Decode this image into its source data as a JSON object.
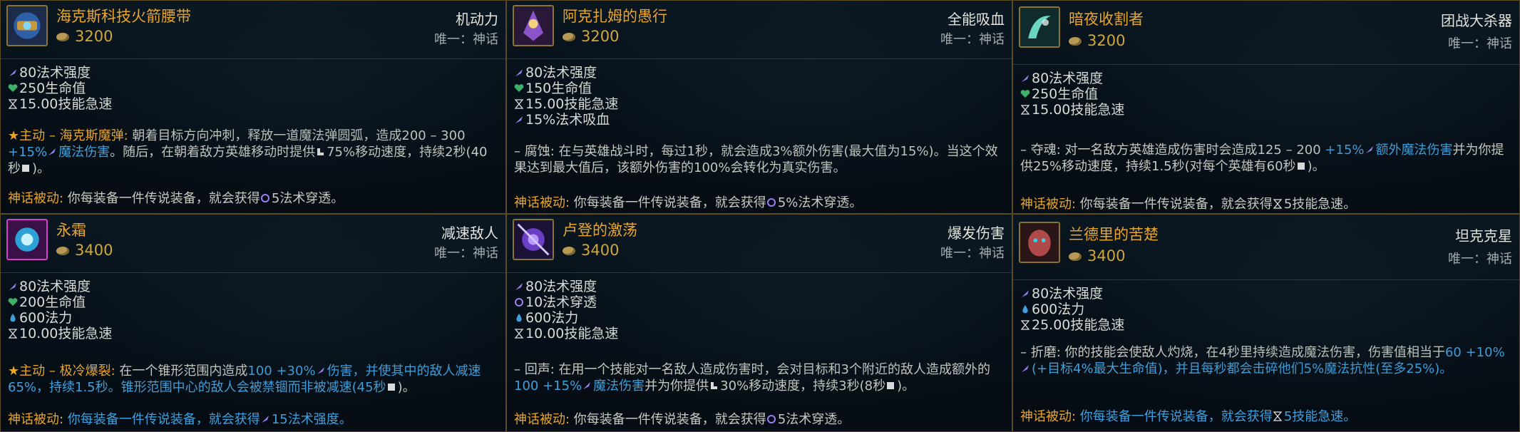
{
  "cards": [
    {
      "name": "海克斯科技火箭腰带",
      "cost": "3200",
      "tag": "机动力",
      "unique": "唯一：神话",
      "stats": [
        "80法术强度",
        "250生命值",
        "15.00技能急速"
      ],
      "desc_label": "★主动 – 海克斯魔弹:",
      "desc_pre": " 朝着目标方向冲刺，释放一道魔法弹圆弧，造成200  –  300",
      "desc_scale": "  +15%",
      "desc_dmg": "魔法伤害",
      "desc_post": "。随后，在朝着敌方英雄移动时提供",
      "desc_post2": "75%移动速度，持续2秒(40秒",
      "desc_end": ")。",
      "mythic_label": "神话被动:",
      "mythic_text": " 你每装备一件传说装备，就会获得",
      "mythic_value": "5法术穿透。"
    },
    {
      "name": "阿克扎姆的愚行",
      "cost": "3200",
      "tag": "全能吸血",
      "unique": "唯一：神话",
      "stats": [
        "80法术强度",
        "150生命值",
        "15.00技能急速",
        "15%法术吸血"
      ],
      "desc_label": "– 腐蚀:",
      "desc_text": " 在与英雄战斗时，每过1秒，就会造成3%额外伤害(最大值为15%)。当这个效果达到最大值后，该额外伤害的100%会转化为真实伤害。",
      "mythic_label": "神话被动:",
      "mythic_text": " 你每装备一件传说装备，就会获得",
      "mythic_value": "5%法术穿透。"
    },
    {
      "name": "暗夜收割者",
      "cost": "3200",
      "tag": "团战大杀器",
      "unique": "唯一：神话",
      "stats": [
        "80法术强度",
        "250生命值",
        "15.00技能急速"
      ],
      "desc_label": "– 夺魂:",
      "desc_pre": " 对一名敌方英雄造成伤害时会造成125  –  200",
      "desc_scale": "  +15%",
      "desc_dmg": "额外魔法伤害",
      "desc_post": "并为你提供25%移动速度，持续1.5秒(对每个英雄有60秒",
      "desc_end": ")。",
      "mythic_label": "神话被动:",
      "mythic_text": " 你每装备一件传说装备，就会获得",
      "mythic_value": "5技能急速。"
    },
    {
      "name": "永霜",
      "cost": "3400",
      "tag": "减速敌人",
      "unique": "唯一：神话",
      "stats": [
        "80法术强度",
        "200生命值",
        "600法力",
        "10.00技能急速"
      ],
      "desc_label": "★主动 – 极冷爆裂:",
      "desc_pre": " 在一个锥形范围内造成",
      "desc_num": "100",
      "desc_scale": "  +30%",
      "desc_dmg": "伤害，并使其中的敌人减速65%，持续1.5秒。锥形范围中心的敌人会被禁锢而非被减速(45秒",
      "desc_end": ")。",
      "mythic_label": "神话被动:",
      "mythic_text": " 你每装备一件传说装备，就会获得",
      "mythic_value": "15法术强度。"
    },
    {
      "name": "卢登的激荡",
      "cost": "3400",
      "tag": "爆发伤害",
      "unique": "唯一：神话",
      "stats": [
        "80法术强度",
        "10法术穿透",
        "600法力",
        "10.00技能急速"
      ],
      "desc_label": "– 回声:",
      "desc_pre": " 在用一个技能对一名敌人造成伤害时，会对目标和3个附近的敌人造成额外的",
      "desc_num": "100",
      "desc_scale": "  +15%",
      "desc_dmg": "魔法伤害",
      "desc_post": "并为你提供",
      "desc_post2": "30%移动速度，持续3秒(8秒",
      "desc_end": ")。",
      "mythic_label": "神话被动:",
      "mythic_text": " 你每装备一件传说装备，就会获得",
      "mythic_value": "5法术穿透。"
    },
    {
      "name": "兰德里的苦楚",
      "cost": "3400",
      "tag": "坦克克星",
      "unique": "唯一：神话",
      "stats": [
        "80法术强度",
        "600法力",
        "25.00技能急速"
      ],
      "desc_label": "– 折磨:",
      "desc_pre": " 你的技能会使敌人灼烧，在4秒里持续造成魔法伤害，伤害值相当于",
      "desc_num": "60",
      "desc_scale": "  +10%",
      "desc_dmg": "(+目标4%最大生命值)，并且每秒都会击碎他们5%魔法抗性(至多25%)。",
      "mythic_label": "神话被动:",
      "mythic_text": " 你每装备一件传说装备，就会获得",
      "mythic_value": "5技能急速。"
    }
  ]
}
